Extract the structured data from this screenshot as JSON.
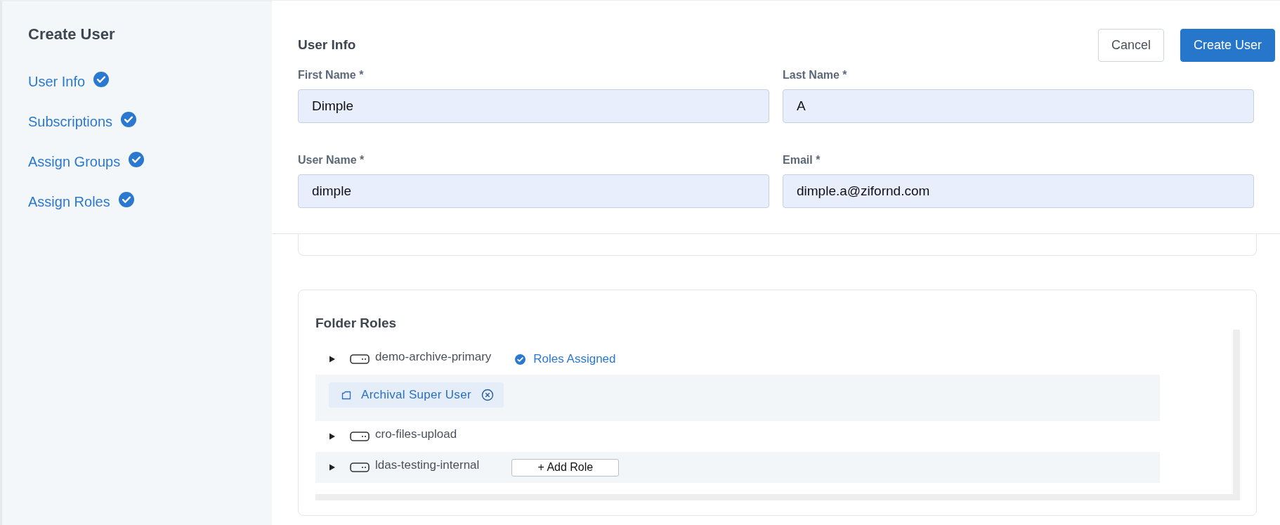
{
  "sidebar": {
    "title": "Create User",
    "steps": [
      {
        "label": "User Info",
        "completed": true
      },
      {
        "label": "Subscriptions",
        "completed": true
      },
      {
        "label": "Assign Groups",
        "completed": true
      },
      {
        "label": "Assign Roles",
        "completed": true
      }
    ]
  },
  "header": {
    "title": "User Info",
    "buttons": [
      {
        "label": "Cancel",
        "kind": "secondary"
      },
      {
        "label": "Create User",
        "kind": "primary"
      }
    ]
  },
  "fields": [
    {
      "label": "First Name *",
      "value": "Dimple"
    },
    {
      "label": "Last Name *",
      "value": "A"
    },
    {
      "label": "User Name *",
      "value": "dimple"
    },
    {
      "label": "Email *",
      "value": "dimple.a@zifornd.com"
    }
  ],
  "folder_roles": {
    "title": "Folder Roles",
    "folders": [
      {
        "name": "demo-archive-primary",
        "status": "Roles Assigned",
        "highlighted": false,
        "roles": [
          {
            "label": "Archival Super User"
          }
        ]
      },
      {
        "name": "cro-files-upload",
        "highlighted": false
      },
      {
        "name": "ldas-testing-internal",
        "highlighted": true,
        "action": "+ Add Role"
      }
    ]
  }
}
